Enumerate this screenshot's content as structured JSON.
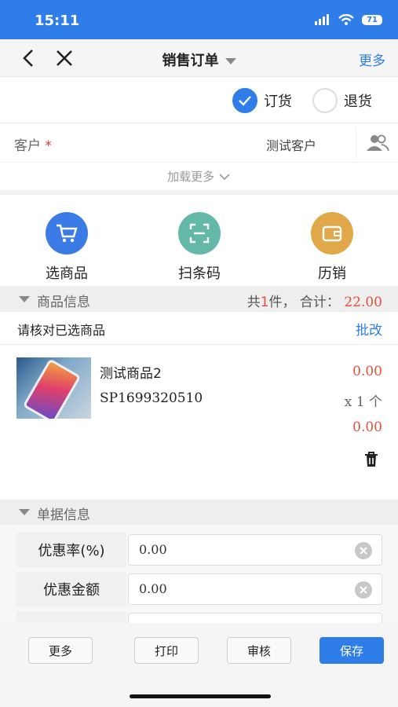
{
  "status": {
    "time": "15:11",
    "battery": "71"
  },
  "nav": {
    "title": "销售订单",
    "more": "更多",
    "back_icon": "chevron-left-icon",
    "close_icon": "close-icon"
  },
  "order_type": {
    "order": "订货",
    "return": "退货",
    "selected": "订货"
  },
  "customer": {
    "label": "客户",
    "required": "*",
    "value": "测试客户"
  },
  "load_more": "加载更多",
  "actions": [
    {
      "label": "选商品",
      "icon": "cart-icon",
      "color": "#3a7be6"
    },
    {
      "label": "扫条码",
      "icon": "scan-icon",
      "color": "#64b8a8"
    },
    {
      "label": "历销",
      "icon": "wallet-icon",
      "color": "#e0a848"
    }
  ],
  "goods_section": {
    "title": "商品信息",
    "count_prefix": "共",
    "count": "1",
    "count_suffix": "件，",
    "total_label": "合计：",
    "total": "22.00"
  },
  "verify": {
    "text": "请核对已选商品",
    "batch": "批改"
  },
  "product": {
    "name": "测试商品2",
    "code": "SP1699320510",
    "price": "0.00",
    "qty": "x 1 个",
    "amount": "0.00"
  },
  "doc_section": {
    "title": "单据信息"
  },
  "fields": [
    {
      "label": "优惠率(%)",
      "value": "0.00"
    },
    {
      "label": "优惠金额",
      "value": "0.00"
    }
  ],
  "footer": {
    "more": "更多",
    "print": "打印",
    "audit": "审核",
    "save": "保存"
  }
}
